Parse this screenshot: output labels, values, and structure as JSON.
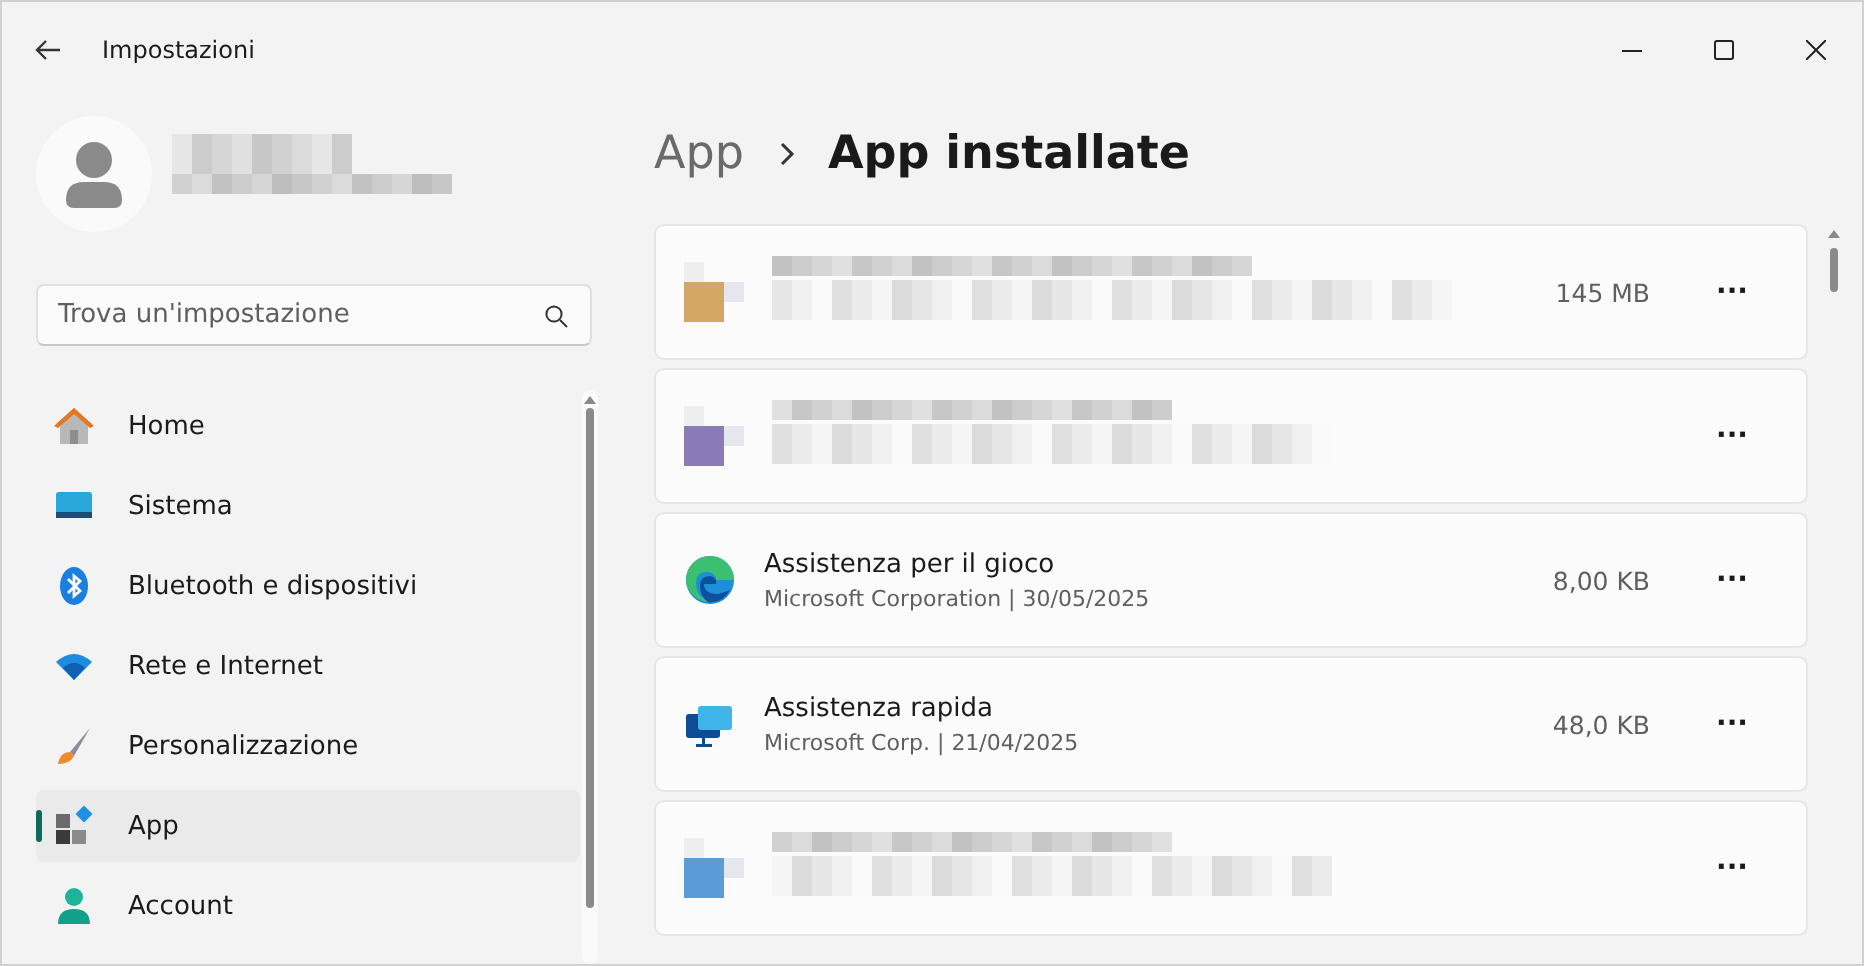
{
  "window": {
    "title": "Impostazioni"
  },
  "search": {
    "placeholder": "Trova un'impostazione"
  },
  "nav": [
    {
      "kind": "home",
      "label": "Home",
      "selected": false
    },
    {
      "kind": "system",
      "label": "Sistema",
      "selected": false
    },
    {
      "kind": "bluetooth",
      "label": "Bluetooth e dispositivi",
      "selected": false
    },
    {
      "kind": "network",
      "label": "Rete e Internet",
      "selected": false
    },
    {
      "kind": "brush",
      "label": "Personalizzazione",
      "selected": false
    },
    {
      "kind": "apps",
      "label": "App",
      "selected": true
    },
    {
      "kind": "account",
      "label": "Account",
      "selected": false
    }
  ],
  "breadcrumb": [
    {
      "label": "App"
    },
    {
      "label": "App installate"
    }
  ],
  "apps": [
    {
      "kind": "blurred",
      "color": "#d4a766",
      "size": "145 MB",
      "more": "···"
    },
    {
      "kind": "blurred",
      "color": "#8a7bb8",
      "more": "···"
    },
    {
      "kind": "edge",
      "name": "Assistenza per il gioco",
      "publisher": "Microsoft Corporation",
      "separator": "|",
      "date": "30/05/2025",
      "size": "8,00 KB",
      "more": "···"
    },
    {
      "kind": "remote",
      "name": "Assistenza rapida",
      "publisher": "Microsoft Corp.",
      "separator": "|",
      "date": "21/04/2025",
      "size": "48,0 KB",
      "more": "···"
    },
    {
      "kind": "blurred",
      "color": "#5b9bd8",
      "more": "···"
    }
  ]
}
